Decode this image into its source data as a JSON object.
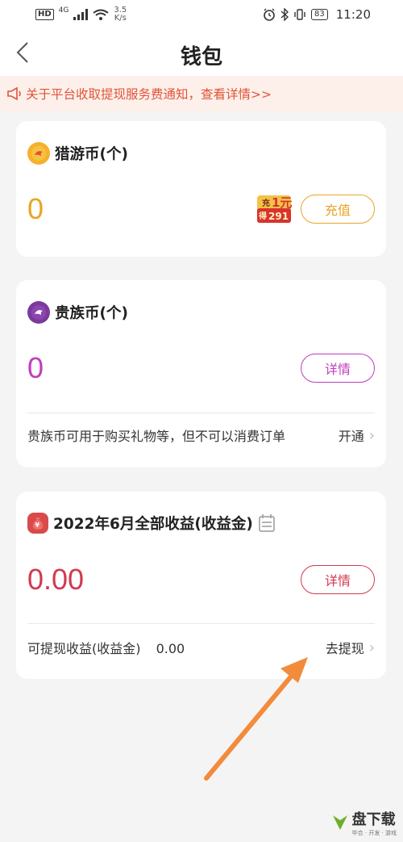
{
  "status_bar": {
    "hd": "HD",
    "network": "4G",
    "speed_value": "3.5",
    "speed_unit": "K/s",
    "battery": "83",
    "time": "11:20"
  },
  "nav": {
    "title": "钱包"
  },
  "notice": {
    "text": "关于平台收取提现服务费通知，查看详情>>"
  },
  "hunting_coin": {
    "title": "猎游币(个)",
    "value": "0",
    "promo_line1": "充",
    "promo_line2": "1元",
    "promo_line3": "得",
    "promo_line4": "291",
    "button": "充值",
    "accent": "#e8a526"
  },
  "noble_coin": {
    "title": "贵族币(个)",
    "value": "0",
    "button": "详情",
    "description": "贵族币可用于购买礼物等，但不可以消费订单",
    "link": "开通",
    "accent": "#c03dbd"
  },
  "earnings": {
    "title": "2022年6月全部收益(收益金)",
    "value": "0.00",
    "button": "详情",
    "withdrawable_label": "可提现收益(收益金)",
    "withdrawable_value": "0.00",
    "link": "去提现",
    "accent": "#d23a4f"
  },
  "watermark": {
    "text": "盘下载",
    "sub": "毕合 · 开发 · 游戏"
  }
}
